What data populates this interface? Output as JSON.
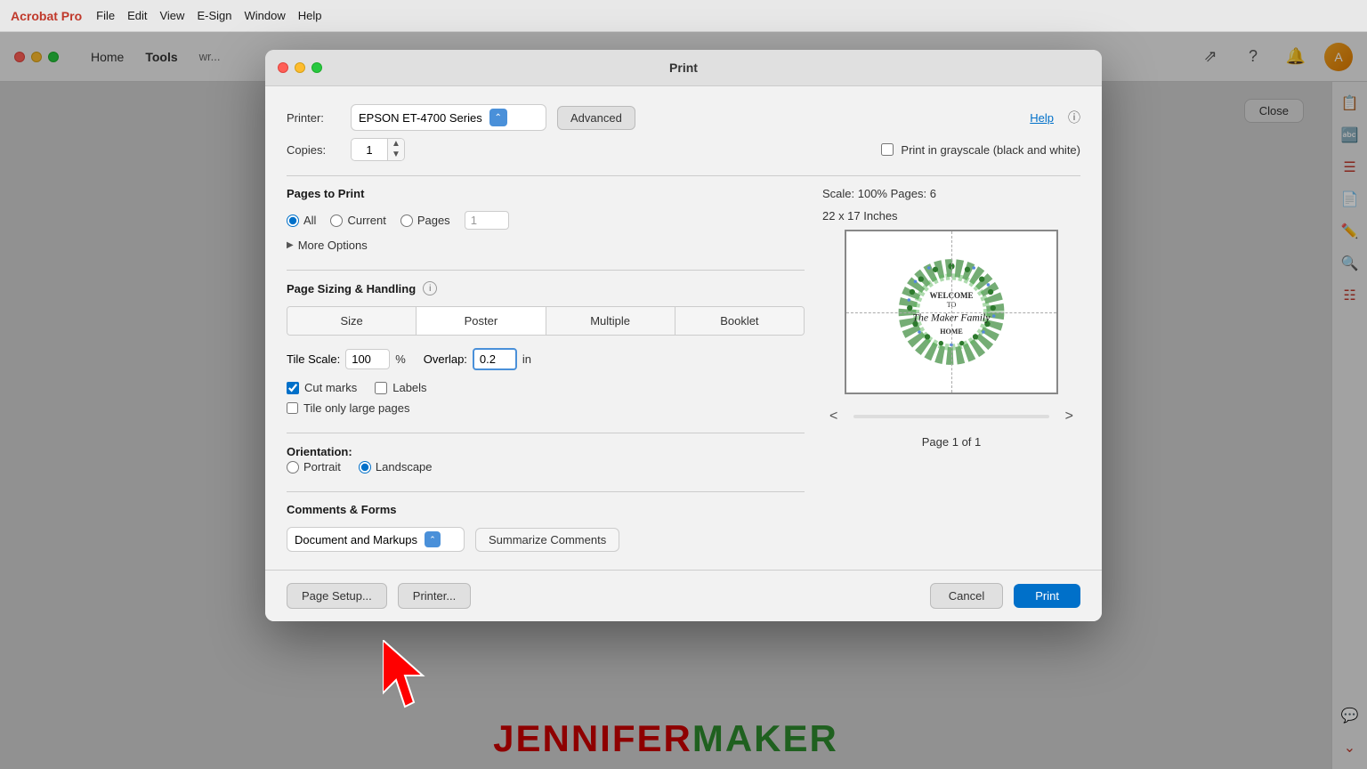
{
  "app": {
    "name": "Acrobat Pro",
    "menu": [
      "File",
      "Edit",
      "View",
      "E-Sign",
      "Window",
      "Help"
    ],
    "nav": [
      "Home",
      "Tools"
    ]
  },
  "dialog": {
    "title": "Print",
    "printer_label": "Printer:",
    "printer_value": "EPSON ET-4700 Series",
    "advanced_btn": "Advanced",
    "help_link": "Help",
    "copies_label": "Copies:",
    "copies_value": "1",
    "grayscale_label": "Print in grayscale (black and white)",
    "pages_section_header": "Pages to Print",
    "pages_options": [
      "All",
      "Current",
      "Pages"
    ],
    "pages_input_placeholder": "1",
    "more_options_label": "More Options",
    "sizing_section_header": "Page Sizing & Handling",
    "sizing_tabs": [
      "Size",
      "Poster",
      "Multiple",
      "Booklet"
    ],
    "active_tab": "Poster",
    "tile_scale_label": "Tile Scale:",
    "tile_scale_value": "100",
    "tile_scale_unit": "%",
    "overlap_label": "Overlap:",
    "overlap_value": "0.2",
    "overlap_unit": "in",
    "cut_marks_label": "Cut marks",
    "labels_label": "Labels",
    "tile_large_pages_label": "Tile only large pages",
    "orientation_header": "Orientation:",
    "orientation_options": [
      "Portrait",
      "Landscape"
    ],
    "active_orientation": "Landscape",
    "comments_header": "Comments & Forms",
    "comments_value": "Document and Markups",
    "summarize_btn": "Summarize Comments",
    "scale_info": "Scale: 100% Pages: 6",
    "page_size_info": "22 x 17 Inches",
    "page_info": "Page 1 of 1",
    "page_setup_btn": "Page Setup...",
    "printer_btn": "Printer...",
    "cancel_btn": "Cancel",
    "print_btn": "Print",
    "close_btn": "Close"
  }
}
